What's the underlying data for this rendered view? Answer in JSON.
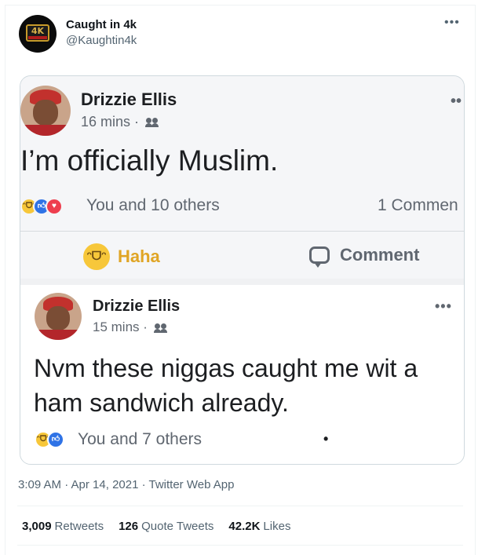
{
  "tweet": {
    "author_name": "Caught in 4k",
    "author_handle": "@Kaughtin4k",
    "avatar_badge": "4K",
    "more_icon": "•••",
    "timestamp": "3:09 AM · Apr 14, 2021 · Twitter Web App",
    "stats": {
      "retweets_count": "3,009",
      "retweets_label": "Retweets",
      "quotes_count": "126",
      "quotes_label": "Quote Tweets",
      "likes_count": "42.2K",
      "likes_label": "Likes"
    }
  },
  "screenshot": {
    "post1": {
      "name": "Drizzie Ellis",
      "time": "16 mins ·",
      "text": "I’m officially Muslim.",
      "reactors": "You and 10 others",
      "comments": "1 Commen",
      "haha_label": "Haha",
      "comment_label": "Comment"
    },
    "post2": {
      "name": "Drizzie Ellis",
      "time": "15 mins ·",
      "text": "Nvm these niggas caught me wit a ham sandwich already.",
      "reactors": "You and 7 others"
    }
  },
  "colors": {
    "twitter_gray": "#536471",
    "fb_gray": "#606770",
    "haha_yellow": "#f7c73a",
    "like_blue": "#2f73e6",
    "love_red": "#ee3e4e"
  }
}
